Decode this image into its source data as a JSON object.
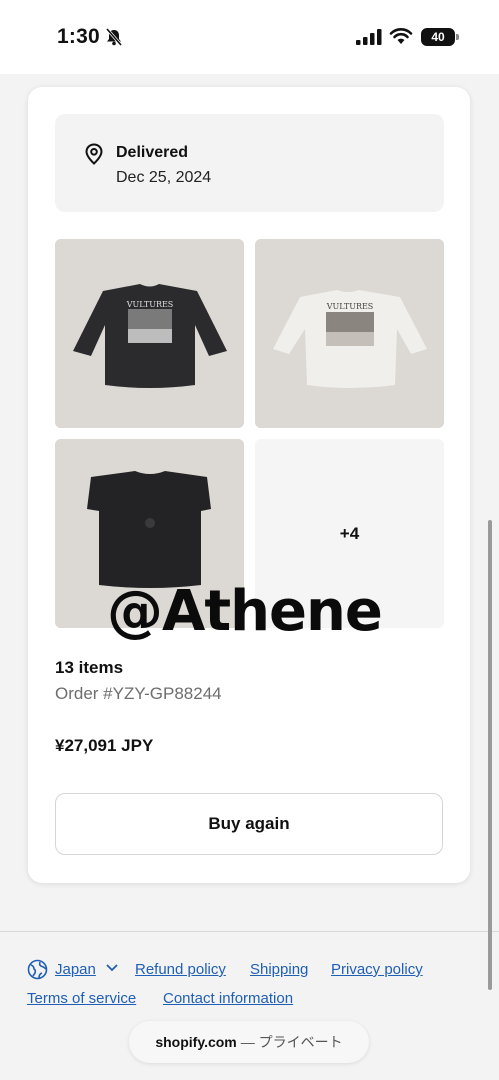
{
  "status_bar": {
    "time": "1:30",
    "battery": "40",
    "icons": [
      "bell-muted-icon",
      "signal-icon",
      "wifi-icon",
      "battery-icon"
    ]
  },
  "order": {
    "delivery_status": "Delivered",
    "delivery_date": "Dec 25, 2024",
    "more_items_label": "+4",
    "item_count": "13 items",
    "order_number": "Order #YZY-GP88244",
    "total": "¥27,091 JPY",
    "buy_again_label": "Buy again",
    "thumbnail_print_text": "VULTURES"
  },
  "watermark": "@Athene",
  "footer": {
    "region": "Japan",
    "links": [
      "Refund policy",
      "Shipping",
      "Privacy policy",
      "Terms of service",
      "Contact information"
    ],
    "link_color": "#1f5fb5"
  },
  "domain_bar": {
    "host": "shopify.com",
    "suffix": "— プライベート"
  }
}
